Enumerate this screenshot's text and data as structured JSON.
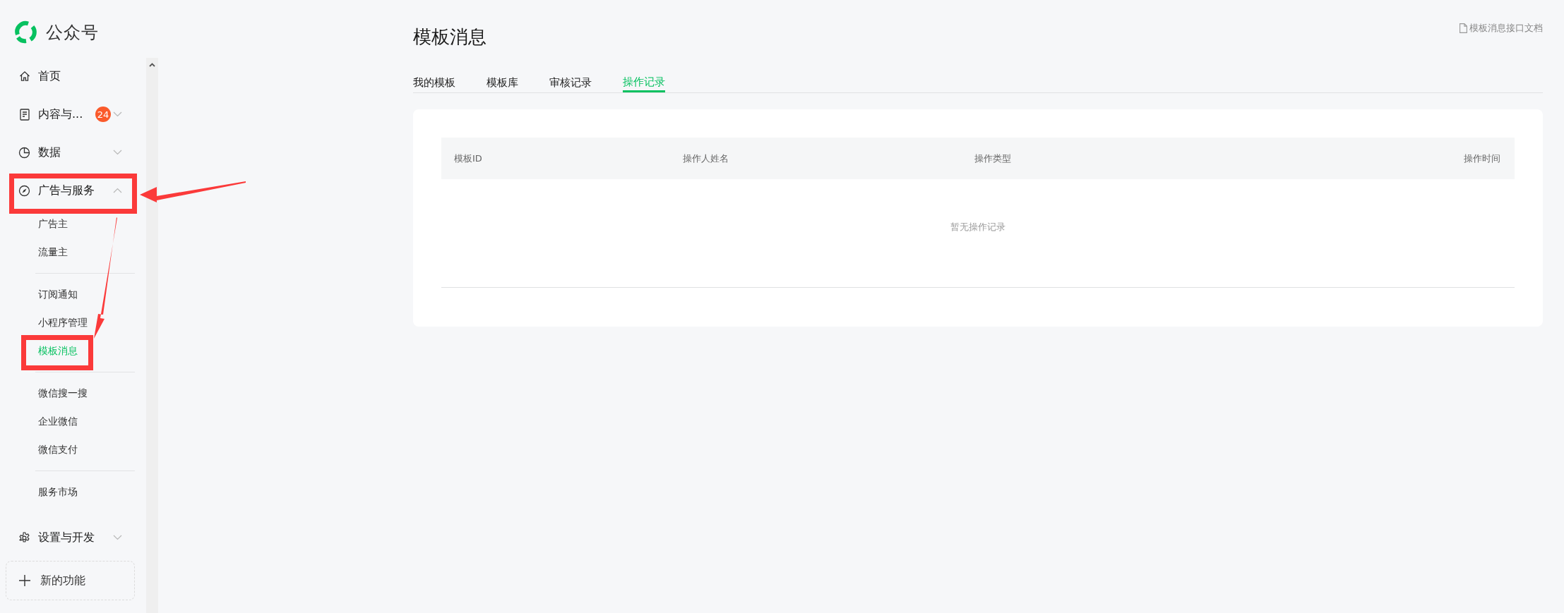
{
  "brand": {
    "name": "公众号"
  },
  "sidebar": {
    "items": [
      {
        "label": "首页",
        "kind": "home"
      },
      {
        "label": "内容与...",
        "kind": "content",
        "badge": "24",
        "expanded": false
      },
      {
        "label": "数据",
        "kind": "data",
        "expanded": false
      },
      {
        "label": "广告与服务",
        "kind": "ads",
        "expanded": true,
        "children": [
          {
            "items": [
              {
                "label": "广告主",
                "selected": false
              },
              {
                "label": "流量主",
                "selected": false
              }
            ]
          },
          {
            "items": [
              {
                "label": "订阅通知",
                "selected": false
              },
              {
                "label": "小程序管理",
                "selected": false
              },
              {
                "label": "模板消息",
                "selected": true
              }
            ]
          },
          {
            "items": [
              {
                "label": "微信搜一搜",
                "selected": false
              },
              {
                "label": "企业微信",
                "selected": false
              },
              {
                "label": "微信支付",
                "selected": false
              }
            ]
          },
          {
            "items": [
              {
                "label": "服务市场",
                "selected": false
              }
            ]
          }
        ]
      },
      {
        "label": "设置与开发",
        "kind": "settings",
        "expanded": false
      }
    ],
    "new_feature_button": "新的功能"
  },
  "page": {
    "title": "模板消息",
    "doc_link": "模板消息接口文档",
    "tabs": [
      {
        "label": "我的模板",
        "selected": false
      },
      {
        "label": "模板库",
        "selected": false
      },
      {
        "label": "审核记录",
        "selected": false
      },
      {
        "label": "操作记录",
        "selected": true
      }
    ],
    "table": {
      "columns": [
        "模板ID",
        "操作人姓名",
        "操作类型",
        "操作时间"
      ],
      "empty_text": "暂无操作记录"
    }
  }
}
